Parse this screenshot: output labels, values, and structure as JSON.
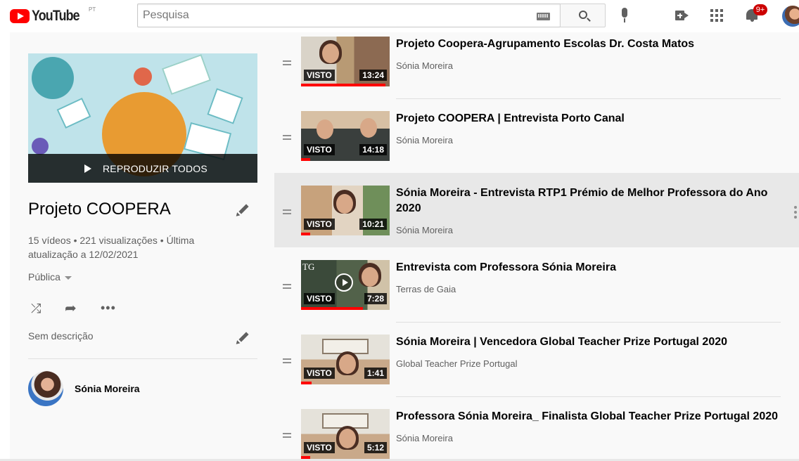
{
  "header": {
    "logo_text": "YouTube",
    "logo_sup": "PT",
    "search_placeholder": "Pesquisa",
    "notification_count": "9+"
  },
  "playlist": {
    "play_all_label": "REPRODUZIR TODOS",
    "title": "Projeto COOPERA",
    "stats": "15 vídeos • 221 visualizações • Última atualização a 12/02/2021",
    "privacy": "Pública",
    "description": "Sem descrição",
    "owner": "Sónia Moreira"
  },
  "videos": [
    {
      "title": "Projeto Coopera-Agrupamento Escolas Dr. Costa Matos",
      "channel": "Sónia Moreira",
      "duration": "13:24",
      "watched_label": "VISTO",
      "progress": 0.95
    },
    {
      "title": "Projeto COOPERA | Entrevista Porto Canal",
      "channel": "Sónia Moreira",
      "duration": "14:18",
      "watched_label": "VISTO",
      "progress": 0.1
    },
    {
      "title": "Sónia Moreira - Entrevista RTP1 Prémio de Melhor Professora do Ano 2020",
      "channel": "Sónia Moreira",
      "duration": "10:21",
      "watched_label": "VISTO",
      "progress": 0.1
    },
    {
      "title": "Entrevista com Professora Sónia Moreira",
      "channel": "Terras de Gaia",
      "duration": "7:28",
      "watched_label": "VISTO",
      "progress": 0.7
    },
    {
      "title": "Sónia Moreira | Vencedora Global Teacher Prize Portugal 2020",
      "channel": "Global Teacher Prize Portugal",
      "duration": "1:41",
      "watched_label": "VISTO",
      "progress": 0.12
    },
    {
      "title": "Professora Sónia Moreira_ Finalista Global Teacher Prize Portugal 2020",
      "channel": "Sónia Moreira",
      "duration": "5:12",
      "watched_label": "VISTO",
      "progress": 0.1
    }
  ],
  "colors": {
    "brand_red": "#ff0000",
    "active_row": "#e8e8e8",
    "panel_bg": "#f9f9f9"
  },
  "icons": [
    "youtube-logo-icon",
    "keyboard-icon",
    "search-icon",
    "microphone-icon",
    "create-video-icon",
    "apps-icon",
    "bell-icon",
    "shuffle-icon",
    "share-icon",
    "more-horizontal-icon",
    "pencil-icon",
    "drag-handle-icon",
    "kebab-menu-icon"
  ]
}
